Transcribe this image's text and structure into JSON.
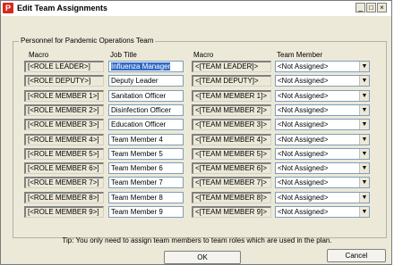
{
  "window": {
    "title": "Edit Team Assignments",
    "app_icon": "P",
    "minimize": "_",
    "maximize": "□",
    "close": "×"
  },
  "group_label": "Personnel for Pandemic Operations Team",
  "headers": {
    "macro1": "Macro",
    "job_title": "Job Title",
    "macro2": "Macro",
    "team_member": "Team Member"
  },
  "rows": [
    {
      "macro": "[<ROLE LEADER>]",
      "job_title": "Influenza Manager",
      "team_macro": "<[TEAM LEADER]>",
      "member": "<Not Assigned>"
    },
    {
      "macro": "[<ROLE DEPUTY>]",
      "job_title": "Deputy Leader",
      "team_macro": "<[TEAM DEPUTY]>",
      "member": "<Not Assigned>"
    },
    {
      "macro": "[<ROLE MEMBER 1>]",
      "job_title": "Sanitation Officer",
      "team_macro": "<[TEAM MEMBER 1]>",
      "member": "<Not Assigned>"
    },
    {
      "macro": "[<ROLE MEMBER 2>]",
      "job_title": "Disinfection Officer",
      "team_macro": "<[TEAM MEMBER 2]>",
      "member": "<Not Assigned>"
    },
    {
      "macro": "[<ROLE MEMBER 3>]",
      "job_title": "Education Officer",
      "team_macro": "<[TEAM MEMBER 3]>",
      "member": "<Not Assigned>"
    },
    {
      "macro": "[<ROLE MEMBER 4>]",
      "job_title": "Team Member 4",
      "team_macro": "<[TEAM MEMBER 4]>",
      "member": "<Not Assigned>"
    },
    {
      "macro": "[<ROLE MEMBER 5>]",
      "job_title": "Team Member 5",
      "team_macro": "<[TEAM MEMBER 5]>",
      "member": "<Not Assigned>"
    },
    {
      "macro": "[<ROLE MEMBER 6>]",
      "job_title": "Team Member 6",
      "team_macro": "<[TEAM MEMBER 6]>",
      "member": "<Not Assigned>"
    },
    {
      "macro": "[<ROLE MEMBER 7>]",
      "job_title": "Team Member 7",
      "team_macro": "<[TEAM MEMBER 7]>",
      "member": "<Not Assigned>"
    },
    {
      "macro": "[<ROLE MEMBER 8>]",
      "job_title": "Team Member 8",
      "team_macro": "<[TEAM MEMBER 8]>",
      "member": "<Not Assigned>"
    },
    {
      "macro": "[<ROLE MEMBER 9>]",
      "job_title": "Team Member 9",
      "team_macro": "<[TEAM MEMBER 9]>",
      "member": "<Not Assigned>"
    }
  ],
  "dropdown_arrow": "▼",
  "tip": "Tip: You only need to assign team members to team roles which are used in the plan.",
  "buttons": {
    "ok": "OK",
    "cancel": "Cancel"
  }
}
